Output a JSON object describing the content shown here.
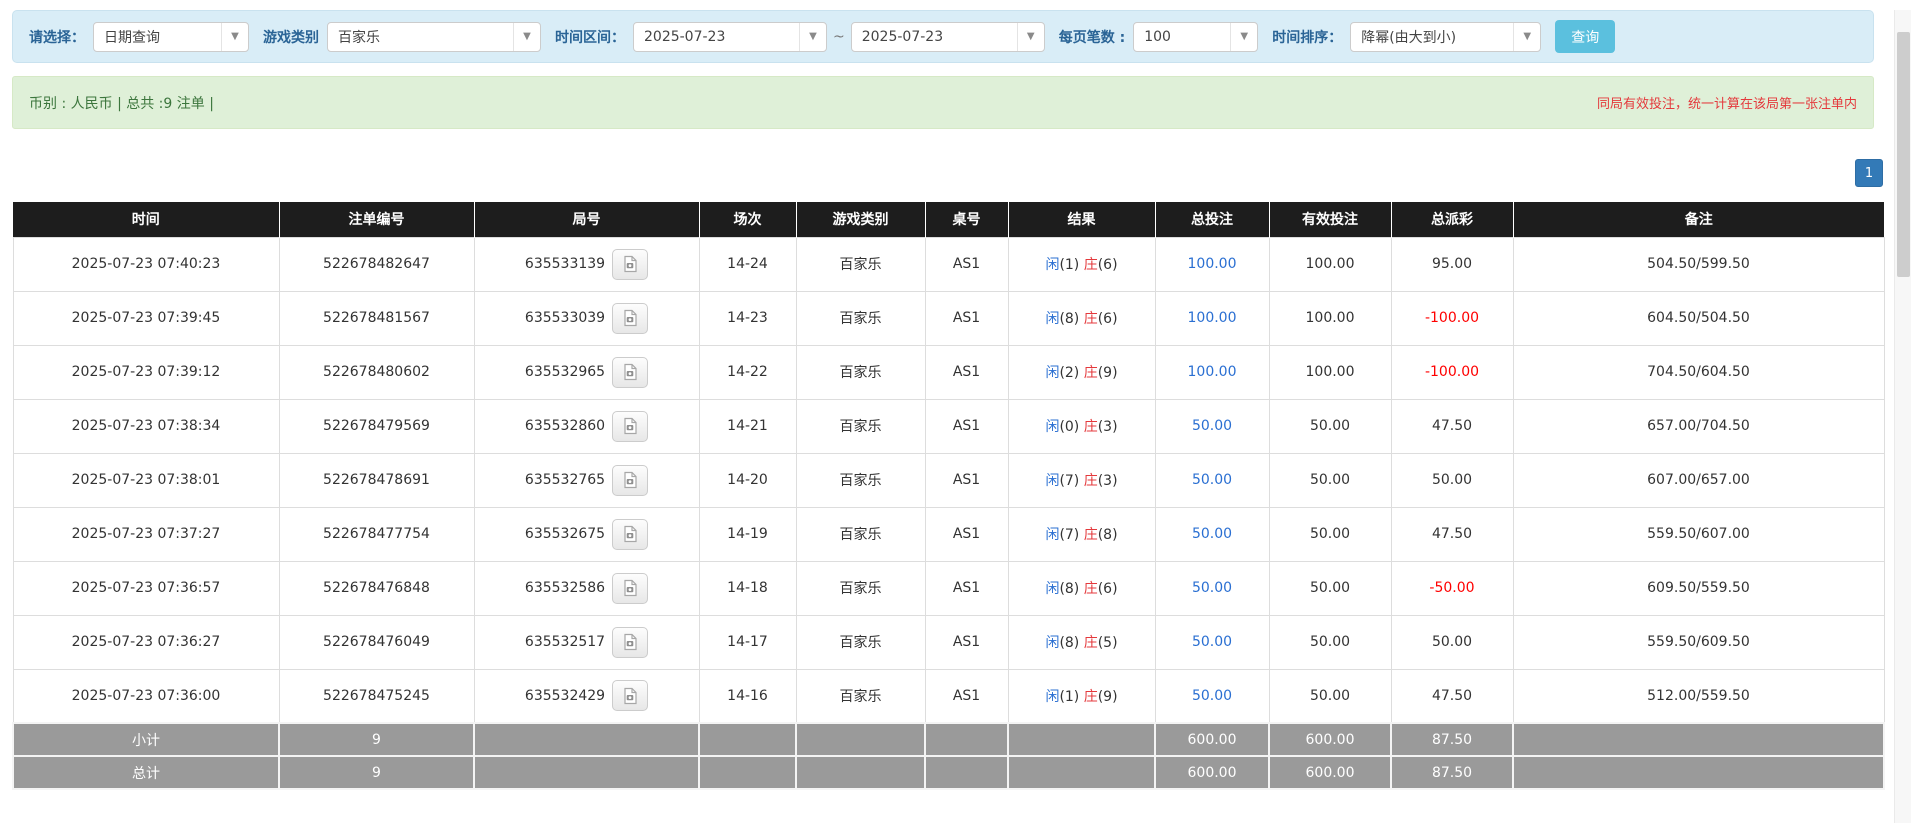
{
  "filter_bar": {
    "select_label": "请选择：",
    "query_type_value": "日期查询",
    "game_label": "游戏类别",
    "game_value": "百家乐",
    "range_label": "时间区间：",
    "date_from": "2025-07-23",
    "range_sep": "~",
    "date_to": "2025-07-23",
    "per_page_label": "每页笔数 :",
    "per_page_value": "100",
    "sort_label": "时间排序：",
    "sort_value": "降幂(由大到小)",
    "search_button": "查询"
  },
  "summary_bar": {
    "info": "币别 : 人民币 | 总共 :9 注单 |",
    "note": "同局有效投注，统一计算在该局第一张注单内"
  },
  "pagination": {
    "current_page": "1"
  },
  "table": {
    "headers": [
      "时间",
      "注单编号",
      "局号",
      "场次",
      "游戏类别",
      "桌号",
      "结果",
      "总投注",
      "有效投注",
      "总派彩",
      "备注"
    ],
    "rows": [
      {
        "time": "2025-07-23 07:40:23",
        "bet_id": "522678482647",
        "round_no": "635533139",
        "session": "14-24",
        "game": "百家乐",
        "table_no": "AS1",
        "player": "闲",
        "player_pts": "(1)",
        "banker": "庄",
        "banker_pts": "(6)",
        "total_bet": "100.00",
        "valid_bet": "100.00",
        "payout": "95.00",
        "payout_negative": false,
        "remark": "504.50/599.50"
      },
      {
        "time": "2025-07-23 07:39:45",
        "bet_id": "522678481567",
        "round_no": "635533039",
        "session": "14-23",
        "game": "百家乐",
        "table_no": "AS1",
        "player": "闲",
        "player_pts": "(8)",
        "banker": "庄",
        "banker_pts": "(6)",
        "total_bet": "100.00",
        "valid_bet": "100.00",
        "payout": "-100.00",
        "payout_negative": true,
        "remark": "604.50/504.50"
      },
      {
        "time": "2025-07-23 07:39:12",
        "bet_id": "522678480602",
        "round_no": "635532965",
        "session": "14-22",
        "game": "百家乐",
        "table_no": "AS1",
        "player": "闲",
        "player_pts": "(2)",
        "banker": "庄",
        "banker_pts": "(9)",
        "total_bet": "100.00",
        "valid_bet": "100.00",
        "payout": "-100.00",
        "payout_negative": true,
        "remark": "704.50/604.50"
      },
      {
        "time": "2025-07-23 07:38:34",
        "bet_id": "522678479569",
        "round_no": "635532860",
        "session": "14-21",
        "game": "百家乐",
        "table_no": "AS1",
        "player": "闲",
        "player_pts": "(0)",
        "banker": "庄",
        "banker_pts": "(3)",
        "total_bet": "50.00",
        "valid_bet": "50.00",
        "payout": "47.50",
        "payout_negative": false,
        "remark": "657.00/704.50"
      },
      {
        "time": "2025-07-23 07:38:01",
        "bet_id": "522678478691",
        "round_no": "635532765",
        "session": "14-20",
        "game": "百家乐",
        "table_no": "AS1",
        "player": "闲",
        "player_pts": "(7)",
        "banker": "庄",
        "banker_pts": "(3)",
        "total_bet": "50.00",
        "valid_bet": "50.00",
        "payout": "50.00",
        "payout_negative": false,
        "remark": "607.00/657.00"
      },
      {
        "time": "2025-07-23 07:37:27",
        "bet_id": "522678477754",
        "round_no": "635532675",
        "session": "14-19",
        "game": "百家乐",
        "table_no": "AS1",
        "player": "闲",
        "player_pts": "(7)",
        "banker": "庄",
        "banker_pts": "(8)",
        "total_bet": "50.00",
        "valid_bet": "50.00",
        "payout": "47.50",
        "payout_negative": false,
        "remark": "559.50/607.00"
      },
      {
        "time": "2025-07-23 07:36:57",
        "bet_id": "522678476848",
        "round_no": "635532586",
        "session": "14-18",
        "game": "百家乐",
        "table_no": "AS1",
        "player": "闲",
        "player_pts": "(8)",
        "banker": "庄",
        "banker_pts": "(6)",
        "total_bet": "50.00",
        "valid_bet": "50.00",
        "payout": "-50.00",
        "payout_negative": true,
        "remark": "609.50/559.50"
      },
      {
        "time": "2025-07-23 07:36:27",
        "bet_id": "522678476049",
        "round_no": "635532517",
        "session": "14-17",
        "game": "百家乐",
        "table_no": "AS1",
        "player": "闲",
        "player_pts": "(8)",
        "banker": "庄",
        "banker_pts": "(5)",
        "total_bet": "50.00",
        "valid_bet": "50.00",
        "payout": "50.00",
        "payout_negative": false,
        "remark": "559.50/609.50"
      },
      {
        "time": "2025-07-23 07:36:00",
        "bet_id": "522678475245",
        "round_no": "635532429",
        "session": "14-16",
        "game": "百家乐",
        "table_no": "AS1",
        "player": "闲",
        "player_pts": "(1)",
        "banker": "庄",
        "banker_pts": "(9)",
        "total_bet": "50.00",
        "valid_bet": "50.00",
        "payout": "47.50",
        "payout_negative": false,
        "remark": "512.00/559.50"
      }
    ],
    "footer_rows": [
      {
        "label": "小计",
        "count": "9",
        "total_bet": "600.00",
        "valid_bet": "600.00",
        "payout": "87.50"
      },
      {
        "label": "总计",
        "count": "9",
        "total_bet": "600.00",
        "valid_bet": "600.00",
        "payout": "87.50"
      }
    ]
  },
  "colors": {
    "accent_button": "#5bc0de",
    "link_blue": "#2a6fd2",
    "player_blue": "#2a6fd2",
    "banker_red": "#e4393c",
    "negative_red": "#ff0000",
    "header_bg": "#1d1d1d",
    "footer_bg": "#9a9a9a",
    "filter_bg": "#d9edf7",
    "summary_bg": "#dff0d8",
    "summary_text": "#3c763d",
    "note_red": "#e4393c",
    "pagination_blue": "#337ab7"
  }
}
